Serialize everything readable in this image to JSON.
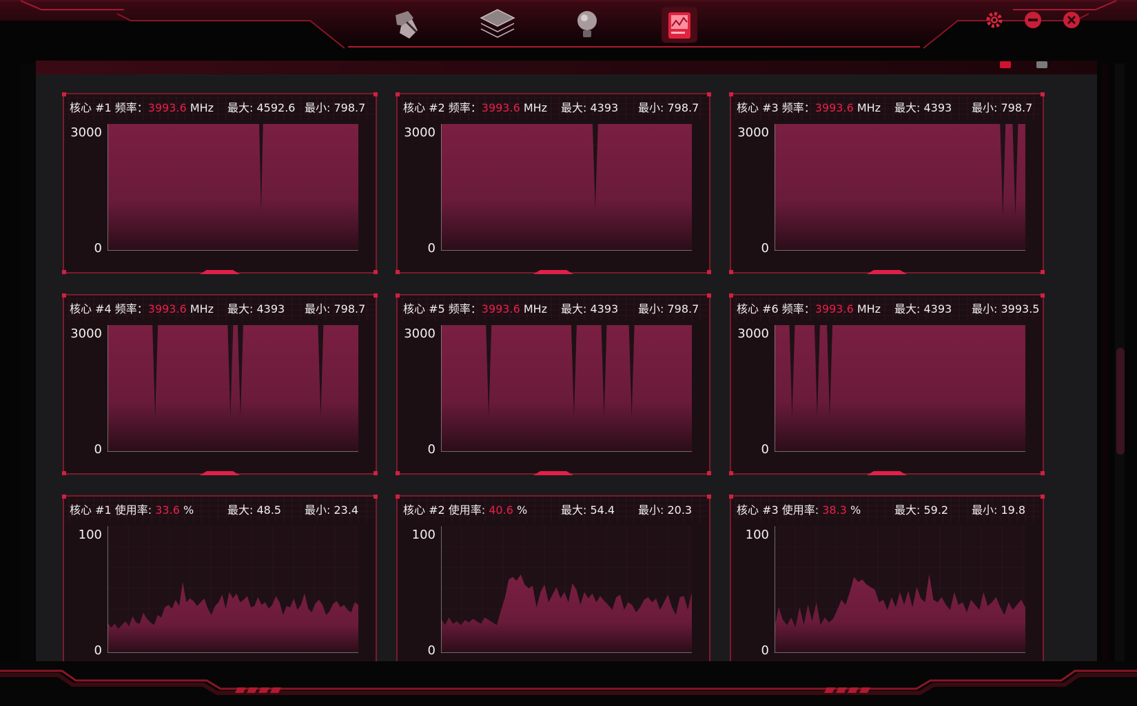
{
  "nav": {
    "icons": [
      "system-tweak-icon",
      "layers-icon",
      "lightbulb-icon",
      "monitor-report-icon"
    ],
    "active_index": 3
  },
  "window": {
    "settings_icon": "gear-icon",
    "minimize_icon": "minimize-icon",
    "close_icon": "close-icon"
  },
  "colors": {
    "accent": "#e8204a",
    "fill": "#7a1f42",
    "frame": "#c0203c"
  },
  "panels": [
    {
      "title_prefix": "核心 #1 频率：",
      "value": "3993.6",
      "unit": " MHz",
      "max_text": "最大: 4592.6",
      "min_text": "最小: 798.7",
      "y_top": "3000",
      "y_bottom": "0",
      "chart_data": {
        "type": "area",
        "ylim": [
          0,
          3000
        ],
        "values": [
          3000,
          3000,
          3000,
          3000,
          3000,
          3000,
          3000,
          3000,
          3000,
          3000,
          3000,
          3000,
          3000,
          3000,
          3000,
          3000,
          3000,
          3000,
          3000,
          3000,
          3000,
          3000,
          3000,
          3000,
          3000,
          3000,
          3000,
          3000,
          3000,
          3000,
          3000,
          3000,
          3000,
          3000,
          3000,
          3000,
          3000,
          3000,
          3000,
          3000,
          3000,
          3000,
          3000,
          3000,
          3000,
          3000,
          3000,
          3000,
          3000,
          3000,
          3000,
          3000,
          3000,
          3000,
          3000,
          3000,
          3000,
          3000,
          3000,
          3000,
          3000,
          3000,
          3000,
          3000,
          3000,
          3000,
          3000,
          3000,
          3000,
          3000,
          3000,
          3000,
          3000,
          3000,
          3000,
          3000,
          3000,
          3000,
          3000,
          900,
          3000,
          3000,
          3000,
          3000,
          3000,
          3000,
          3000,
          3000,
          3000,
          3000,
          3000,
          3000,
          3000,
          3000,
          3000,
          3000,
          3000,
          3000,
          3000,
          3000,
          3000,
          3000,
          3000,
          3000,
          3000,
          3000,
          3000,
          3000,
          3000,
          3000,
          3000,
          3000,
          3000,
          3000,
          3000,
          3000,
          3000,
          3000,
          3000,
          3000,
          3000,
          3000,
          3000,
          3000,
          3000,
          3000,
          3000,
          3000,
          3000,
          3000
        ]
      }
    },
    {
      "title_prefix": "核心 #2 频率：",
      "value": "3993.6",
      "unit": " MHz",
      "max_text": "最大: 4393",
      "min_text": "最小: 798.7",
      "y_top": "3000",
      "y_bottom": "0",
      "chart_data": {
        "type": "area",
        "ylim": [
          0,
          3000
        ],
        "values": [
          3000,
          3000,
          3000,
          3000,
          3000,
          3000,
          3000,
          3000,
          3000,
          3000,
          3000,
          3000,
          3000,
          3000,
          3000,
          3000,
          3000,
          3000,
          3000,
          3000,
          3000,
          3000,
          3000,
          3000,
          3000,
          3000,
          3000,
          3000,
          3000,
          3000,
          3000,
          3000,
          3000,
          3000,
          3000,
          3000,
          3000,
          3000,
          3000,
          3000,
          3000,
          3000,
          3000,
          3000,
          3000,
          3000,
          3000,
          3000,
          3000,
          3000,
          3000,
          3000,
          3000,
          3000,
          3000,
          3000,
          3000,
          3000,
          3000,
          3000,
          3000,
          3000,
          3000,
          3000,
          3000,
          3000,
          3000,
          3000,
          3000,
          3000,
          3000,
          3000,
          3000,
          3000,
          3000,
          3000,
          3000,
          3000,
          3000,
          3000,
          3000,
          3000,
          3000,
          3000,
          3000,
          3000,
          3000,
          3000,
          3000,
          3000,
          3000,
          3000,
          3000,
          3000,
          3000,
          3000,
          3000,
          3000,
          3000,
          3000,
          3000,
          3000,
          3000,
          3000,
          3000,
          3000,
          3000,
          3000,
          3000,
          3000,
          3000,
          3000,
          3000,
          3000,
          3000,
          3000,
          3000,
          3000,
          3000,
          3000,
          3000,
          3000,
          3000,
          3000,
          3000,
          3000,
          3000,
          3000,
          3000,
          3000
        ],
        "dips": [
          [
            0.615,
            1000
          ]
        ]
      }
    },
    {
      "title_prefix": "核心 #3 频率：",
      "value": "3993.6",
      "unit": " MHz",
      "max_text": "最大: 4393",
      "min_text": "最小: 798.7",
      "y_top": "3000",
      "y_bottom": "0",
      "chart_data": {
        "type": "area",
        "ylim": [
          0,
          3000
        ],
        "dips": [
          [
            0.91,
            800
          ],
          [
            0.96,
            800
          ]
        ]
      }
    },
    {
      "title_prefix": "核心 #4 频率：",
      "value": "3993.6",
      "unit": " MHz",
      "max_text": "最大: 4393",
      "min_text": "最小: 798.7",
      "y_top": "3000",
      "y_bottom": "0",
      "chart_data": {
        "type": "area",
        "ylim": [
          0,
          3000
        ],
        "dips": [
          [
            0.19,
            800
          ],
          [
            0.49,
            800
          ],
          [
            0.53,
            800
          ],
          [
            0.85,
            800
          ]
        ]
      }
    },
    {
      "title_prefix": "核心 #5 频率：",
      "value": "3993.6",
      "unit": " MHz",
      "max_text": "最大: 4393",
      "min_text": "最小: 798.7",
      "y_top": "3000",
      "y_bottom": "0",
      "chart_data": {
        "type": "area",
        "ylim": [
          0,
          3000
        ],
        "dips": [
          [
            0.19,
            800
          ],
          [
            0.53,
            800
          ],
          [
            0.65,
            800
          ],
          [
            0.76,
            800
          ]
        ]
      }
    },
    {
      "title_prefix": "核心 #6 频率：",
      "value": "3993.6",
      "unit": " MHz",
      "max_text": "最大: 4393",
      "min_text": "最小: 3993.5",
      "y_top": "3000",
      "y_bottom": "0",
      "chart_data": {
        "type": "area",
        "ylim": [
          0,
          3000
        ],
        "dips": [
          [
            0.07,
            800
          ],
          [
            0.17,
            800
          ],
          [
            0.22,
            800
          ]
        ]
      }
    },
    {
      "title_prefix": "核心 #1 使用率: ",
      "value": "33.6",
      "unit": " %",
      "max_text": "最大: 48.5",
      "min_text": "最小: 23.4",
      "y_top": "100",
      "y_bottom": "0",
      "chart_data": {
        "type": "area",
        "ylim": [
          0,
          100
        ],
        "values": [
          24,
          20,
          23,
          19,
          22,
          25,
          21,
          29,
          24,
          23,
          32,
          27,
          24,
          22,
          30,
          28,
          36,
          38,
          35,
          42,
          37,
          56,
          40,
          43,
          41,
          37,
          40,
          43,
          35,
          30,
          37,
          40,
          46,
          35,
          48,
          43,
          47,
          40,
          42,
          45,
          36,
          37,
          44,
          38,
          40,
          35,
          38,
          45,
          40,
          30,
          37,
          36,
          43,
          34,
          38,
          47,
          35,
          32,
          39,
          42,
          38,
          30,
          33,
          39,
          41,
          36,
          38,
          34,
          32,
          40,
          38
        ]
      }
    },
    {
      "title_prefix": "核心 #2 使用率: ",
      "value": "40.6",
      "unit": " %",
      "max_text": "最大: 54.4",
      "min_text": "最小: 20.3",
      "y_top": "100",
      "y_bottom": "0",
      "chart_data": {
        "type": "area",
        "ylim": [
          0,
          100
        ],
        "values": [
          27,
          22,
          28,
          23,
          25,
          22,
          26,
          24,
          27,
          25,
          23,
          28,
          26,
          24,
          22,
          33,
          43,
          58,
          60,
          57,
          62,
          54,
          51,
          53,
          36,
          48,
          54,
          40,
          46,
          52,
          43,
          48,
          40,
          55,
          50,
          38,
          48,
          43,
          47,
          40,
          45,
          41,
          38,
          34,
          44,
          46,
          34,
          40,
          38,
          32,
          36,
          42,
          44,
          40,
          43,
          34,
          40,
          46,
          36,
          30,
          44,
          45,
          34,
          48
        ]
      }
    },
    {
      "title_prefix": "核心 #3 使用率: ",
      "value": "38.3",
      "unit": " %",
      "max_text": "最大: 59.2",
      "min_text": "最小: 19.8",
      "y_top": "100",
      "y_bottom": "0",
      "chart_data": {
        "type": "area",
        "ylim": [
          0,
          100
        ],
        "values": [
          20,
          36,
          26,
          22,
          28,
          20,
          36,
          22,
          38,
          25,
          40,
          22,
          28,
          24,
          27,
          34,
          42,
          38,
          48,
          60,
          56,
          58,
          54,
          52,
          50,
          40,
          42,
          34,
          44,
          36,
          48,
          38,
          49,
          36,
          52,
          43,
          40,
          62,
          42,
          40,
          44,
          38,
          34,
          48,
          38,
          40,
          32,
          42,
          38,
          34,
          48,
          37,
          40,
          44,
          36,
          30,
          40,
          34,
          38,
          42,
          36
        ]
      }
    }
  ]
}
